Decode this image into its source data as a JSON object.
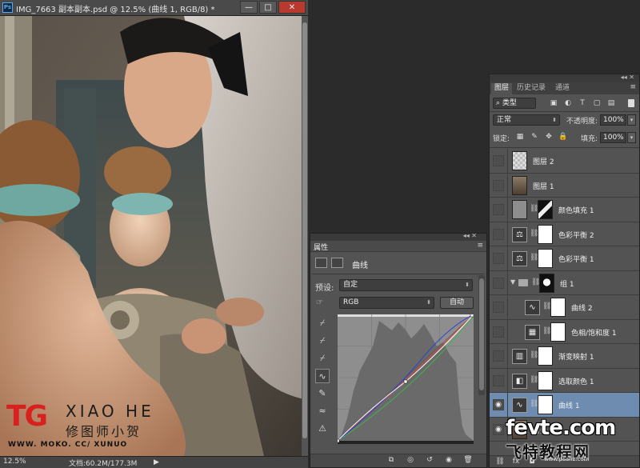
{
  "document": {
    "title": "IMG_7663 副本副本.psd @ 12.5% (曲线 1, RGB/8) *",
    "ps_icon": "Ps",
    "window_buttons": {
      "minimize": "—",
      "maximize": "□",
      "close": "✕"
    },
    "status": {
      "zoom": "12.5%",
      "doc_size": "文档:60.2M/177.3M",
      "arrow": "▶"
    }
  },
  "watermark": {
    "brand": "TG",
    "name": "XIAO HE",
    "chinese": "修图师小贺",
    "url": "WWW. MOKO. CC/ XUNUO"
  },
  "properties_panel": {
    "collapse_glyph": "◂◂ ✕",
    "tab": "属性",
    "menu_glyph": "≡",
    "title": "曲线",
    "preset_label": "预设:",
    "preset_value": "自定",
    "channel_value": "RGB",
    "auto_button": "自动",
    "tools": [
      "on-image-adjust-icon",
      "sample-black-eyedropper-icon",
      "sample-gray-eyedropper-icon",
      "sample-white-eyedropper-icon",
      "edit-points-curve-icon",
      "draw-pencil-icon",
      "smooth-curve-icon",
      "clipping-warning-icon"
    ],
    "footer_icons": [
      "clip-to-layer-icon",
      "view-previous-icon",
      "reset-icon",
      "visibility-icon",
      "delete-icon"
    ],
    "curves": {
      "rgb_points": [
        [
          0,
          0
        ],
        [
          128,
          118
        ],
        [
          255,
          255
        ]
      ],
      "colors": {
        "rgb": "#ffffff",
        "blue": "#2a3ad8",
        "green": "#3cb84a",
        "red": "#e04030"
      }
    }
  },
  "layers_panel": {
    "collapse_glyph": "◂◂ ✕",
    "tabs": [
      {
        "label": "图层",
        "active": true
      },
      {
        "label": "历史记录",
        "active": false
      },
      {
        "label": "通道",
        "active": false
      }
    ],
    "menu_glyph": "≡",
    "filter_value": "类型",
    "blend_mode": "正常",
    "opacity_label": "不透明度:",
    "opacity_value": "100%",
    "lock_label": "锁定:",
    "fill_label": "填充:",
    "fill_value": "100%",
    "layers": [
      {
        "name": "图层 2",
        "visible": false,
        "thumb": "trans",
        "indent": false,
        "selected": false
      },
      {
        "name": "图层 1",
        "visible": false,
        "thumb": "photo",
        "indent": false,
        "selected": false
      },
      {
        "name": "颜色填充 1",
        "visible": false,
        "thumb": "gray",
        "mask": "mask-dark",
        "indent": false,
        "selected": false
      },
      {
        "name": "色彩平衡 2",
        "visible": false,
        "adj": "balance-icon",
        "mask": "white",
        "indent": false,
        "selected": false
      },
      {
        "name": "色彩平衡 1",
        "visible": false,
        "adj": "balance-icon",
        "mask": "white",
        "indent": false,
        "selected": false
      },
      {
        "name": "组 1",
        "visible": false,
        "group": true,
        "mask": "mask-group",
        "indent": false,
        "selected": false
      },
      {
        "name": "曲线 2",
        "visible": false,
        "adj": "curves-icon",
        "mask": "white",
        "indent": true,
        "selected": false
      },
      {
        "name": "色相/饱和度 1",
        "visible": false,
        "adj": "hue-sat-icon",
        "mask": "white",
        "indent": true,
        "selected": false
      },
      {
        "name": "渐变映射 1",
        "visible": false,
        "adj": "gradient-map-icon",
        "mask": "white",
        "indent": false,
        "selected": false
      },
      {
        "name": "选取颜色 1",
        "visible": false,
        "adj": "selective-color-icon",
        "mask": "white",
        "indent": false,
        "selected": false
      },
      {
        "name": "曲线 1",
        "visible": true,
        "adj": "curves-icon",
        "mask": "white",
        "indent": false,
        "selected": true
      },
      {
        "name": "背景",
        "visible": true,
        "thumb": "photo",
        "indent": false,
        "selected": false
      }
    ]
  },
  "site_watermark": {
    "main": "fevte.com",
    "chinese": "飞特教程网",
    "url": "www.psahz.com"
  }
}
